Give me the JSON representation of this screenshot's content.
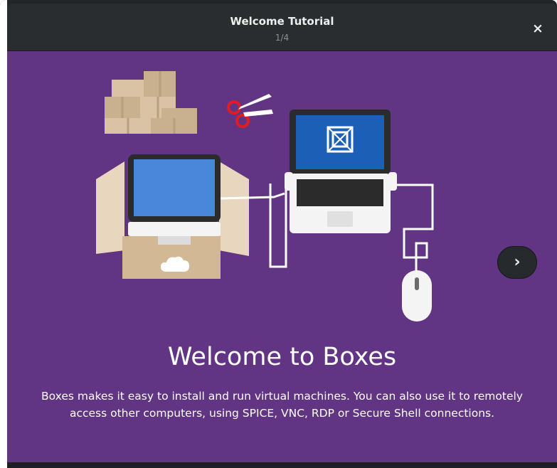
{
  "window": {
    "title": "Welcome Tutorial",
    "page_indicator": "1/4",
    "close_symbol": "×"
  },
  "slide": {
    "heading": "Welcome to Boxes",
    "description": "Boxes makes it easy to install and run virtual machines. You can also use it to remotely access other computers, using SPICE, VNC, RDP or Secure Shell connections.",
    "next_symbol": "›"
  },
  "colors": {
    "background": "#613583",
    "titlebar": "#2a2d30"
  },
  "icons": [
    "close-icon",
    "chevron-right-icon",
    "boxes-illustration"
  ]
}
